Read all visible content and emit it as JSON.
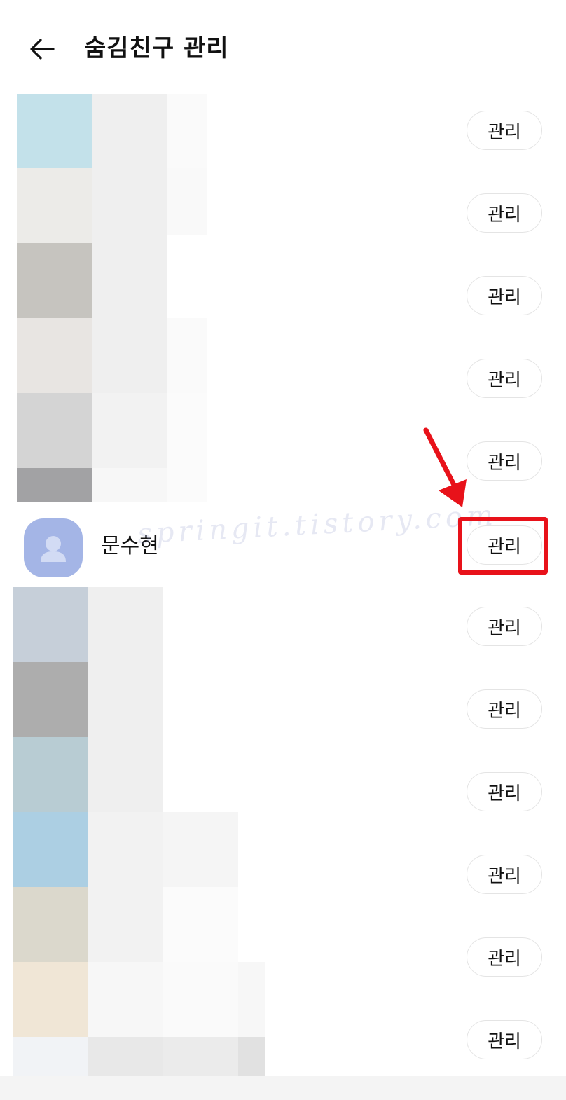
{
  "header": {
    "title": "숨김친구 관리",
    "back_icon": "arrow-left-icon"
  },
  "rows": [
    {
      "button_label": "관리",
      "name": ""
    },
    {
      "button_label": "관리",
      "name": ""
    },
    {
      "button_label": "관리",
      "name": ""
    },
    {
      "button_label": "관리",
      "name": ""
    },
    {
      "button_label": "관리",
      "name": ""
    },
    {
      "button_label": "관리",
      "name": "문수현",
      "avatar_icon": "person-icon",
      "highlighted": true
    },
    {
      "button_label": "관리",
      "name": ""
    },
    {
      "button_label": "관리",
      "name": ""
    },
    {
      "button_label": "관리",
      "name": ""
    },
    {
      "button_label": "관리",
      "name": ""
    },
    {
      "button_label": "관리",
      "name": ""
    },
    {
      "button_label": "관리",
      "name": ""
    }
  ],
  "watermark": "springit.tistory.com",
  "colors": {
    "highlight": "#e8121a",
    "avatar": "#a4b5e6"
  }
}
